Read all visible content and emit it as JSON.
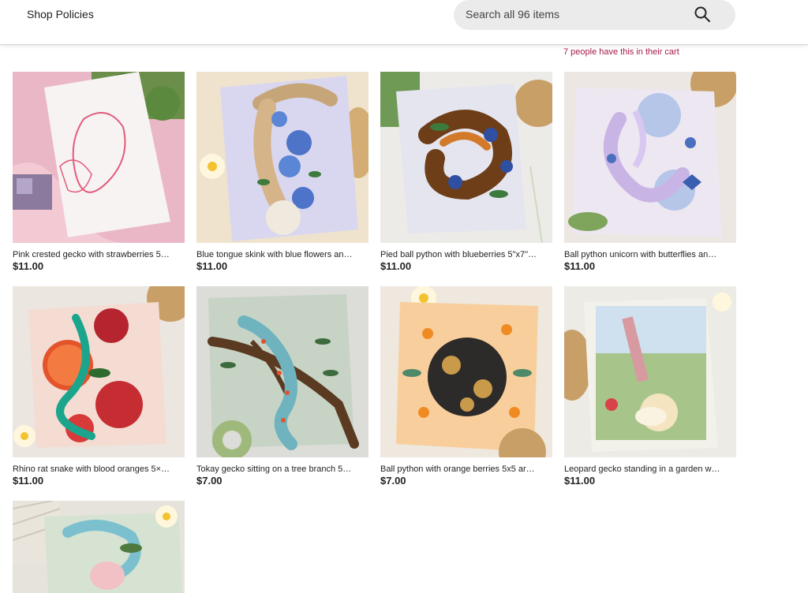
{
  "header": {
    "shop_policies_label": "Shop Policies",
    "search": {
      "placeholder": "Search all 96 items"
    }
  },
  "cart_note": "7 people have this in their cart",
  "listings": [
    {
      "title": "Pink crested gecko with strawberries 5…",
      "price": "$11.00"
    },
    {
      "title": "Blue tongue skink with blue flowers an…",
      "price": "$11.00"
    },
    {
      "title": "Pied ball python with blueberries 5\"x7\"…",
      "price": "$11.00"
    },
    {
      "title": "Ball python unicorn with butterflies an…",
      "price": "$11.00"
    },
    {
      "title": "Rhino rat snake with blood oranges 5×…",
      "price": "$11.00"
    },
    {
      "title": "Tokay gecko sitting on a tree branch 5…",
      "price": "$7.00"
    },
    {
      "title": "Ball python with orange berries 5x5 ar…",
      "price": "$7.00"
    },
    {
      "title": "Leopard gecko standing in a garden w…",
      "price": "$11.00"
    },
    {
      "title": "",
      "price": ""
    }
  ]
}
